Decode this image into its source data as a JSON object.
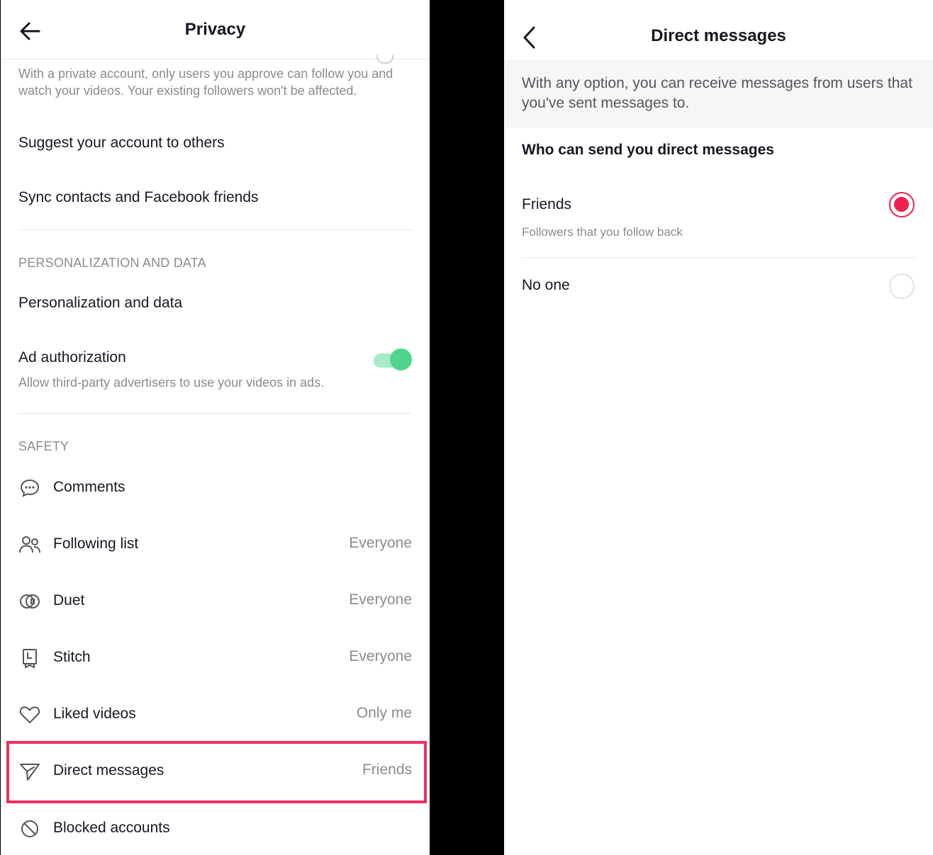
{
  "privacy": {
    "title": "Privacy",
    "private_desc": "With a private account, only users you approve can follow you and watch your videos. Your existing followers won't be affected.",
    "suggest_label": "Suggest your account to others",
    "sync_label": "Sync contacts and Facebook friends",
    "personalization_header": "PERSONALIZATION AND DATA",
    "personalization_label": "Personalization and data",
    "ad_auth_label": "Ad authorization",
    "ad_auth_desc": "Allow third-party advertisers to use your videos in ads.",
    "ad_auth_on": true,
    "safety_header": "SAFETY",
    "safety_items": [
      {
        "icon": "comment-icon",
        "label": "Comments",
        "value": ""
      },
      {
        "icon": "following-icon",
        "label": "Following list",
        "value": "Everyone"
      },
      {
        "icon": "duet-icon",
        "label": "Duet",
        "value": "Everyone"
      },
      {
        "icon": "stitch-icon",
        "label": "Stitch",
        "value": "Everyone"
      },
      {
        "icon": "heart-icon",
        "label": "Liked videos",
        "value": "Only me"
      },
      {
        "icon": "send-icon",
        "label": "Direct messages",
        "value": "Friends"
      },
      {
        "icon": "blocked-icon",
        "label": "Blocked accounts",
        "value": ""
      }
    ],
    "highlight_color": "#ee2f5f",
    "toggle_color": "#4fd58e"
  },
  "dm": {
    "title": "Direct messages",
    "info": "With any option, you can receive messages from users that you've sent messages to.",
    "section": "Who can send you direct messages",
    "options": [
      {
        "label": "Friends",
        "sub": "Followers that you follow back",
        "selected": true
      },
      {
        "label": "No one",
        "sub": "",
        "selected": false
      }
    ],
    "accent_color": "#f1204f"
  }
}
